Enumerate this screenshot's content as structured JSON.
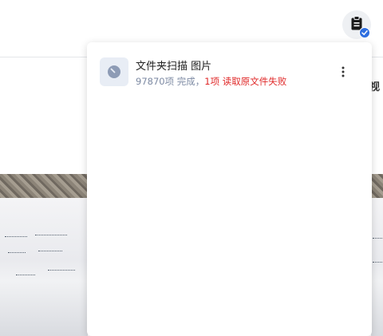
{
  "header": {
    "tasks_icon": "task-list-icon",
    "badge_icon": "check-badge-icon"
  },
  "background": {
    "side_text": "视"
  },
  "task_panel": {
    "tasks": [
      {
        "icon": "folder-scan-icon",
        "title": "文件夹扫描 图片",
        "status_ok": "97870项 完成，",
        "status_fail": "1项 读取原文件失败",
        "more_icon": "more-vertical-icon"
      }
    ]
  },
  "colors": {
    "accent": "#2f6fe0",
    "error": "#e02929",
    "muted": "#7d8aa3"
  }
}
